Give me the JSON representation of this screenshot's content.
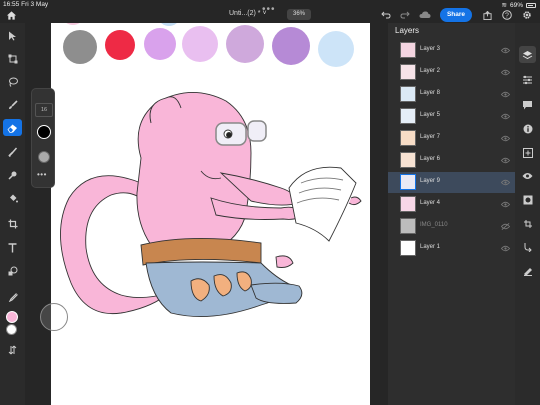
{
  "status_bar": {
    "time": "16:55",
    "date": "Fri 3 May",
    "battery": "69%"
  },
  "header": {
    "title": "Unti...(2) *",
    "title_suffix": "˅",
    "zoom": "36%",
    "share_label": "Share",
    "dots": "•••"
  },
  "brush_panel": {
    "size": "16",
    "more": "•••"
  },
  "colors": {
    "accent": "#1473e6",
    "foreground_swatch": "#f9b6d8",
    "background_swatch": "#ffffff",
    "palette": [
      "#8e8e8e",
      "#ee2a45",
      "#d9a2ec",
      "#e9bff0",
      "#cfa9dc",
      "#b68ad6",
      "#cde4f8"
    ]
  },
  "left_tools": [
    {
      "name": "home-icon"
    },
    {
      "name": "select-icon"
    },
    {
      "name": "transform-icon"
    },
    {
      "name": "lasso-icon"
    },
    {
      "name": "brush-icon"
    },
    {
      "name": "eraser-icon"
    },
    {
      "name": "smudge-icon"
    },
    {
      "name": "clone-icon"
    },
    {
      "name": "fill-icon"
    },
    {
      "name": "crop-icon"
    },
    {
      "name": "text-icon"
    },
    {
      "name": "shape-icon"
    },
    {
      "name": "eyedropper-icon"
    }
  ],
  "layers_panel": {
    "title": "Layers",
    "layers": [
      {
        "name": "Layer 3",
        "visible": true
      },
      {
        "name": "Layer 2",
        "visible": true
      },
      {
        "name": "Layer 8",
        "visible": true
      },
      {
        "name": "Layer 5",
        "visible": true
      },
      {
        "name": "Layer 7",
        "visible": true
      },
      {
        "name": "Layer 6",
        "visible": true
      },
      {
        "name": "Layer 9",
        "visible": true,
        "selected": true
      },
      {
        "name": "Layer 4",
        "visible": true
      },
      {
        "name": "IMG_0110",
        "visible": false
      },
      {
        "name": "Layer 1",
        "visible": true
      }
    ]
  }
}
